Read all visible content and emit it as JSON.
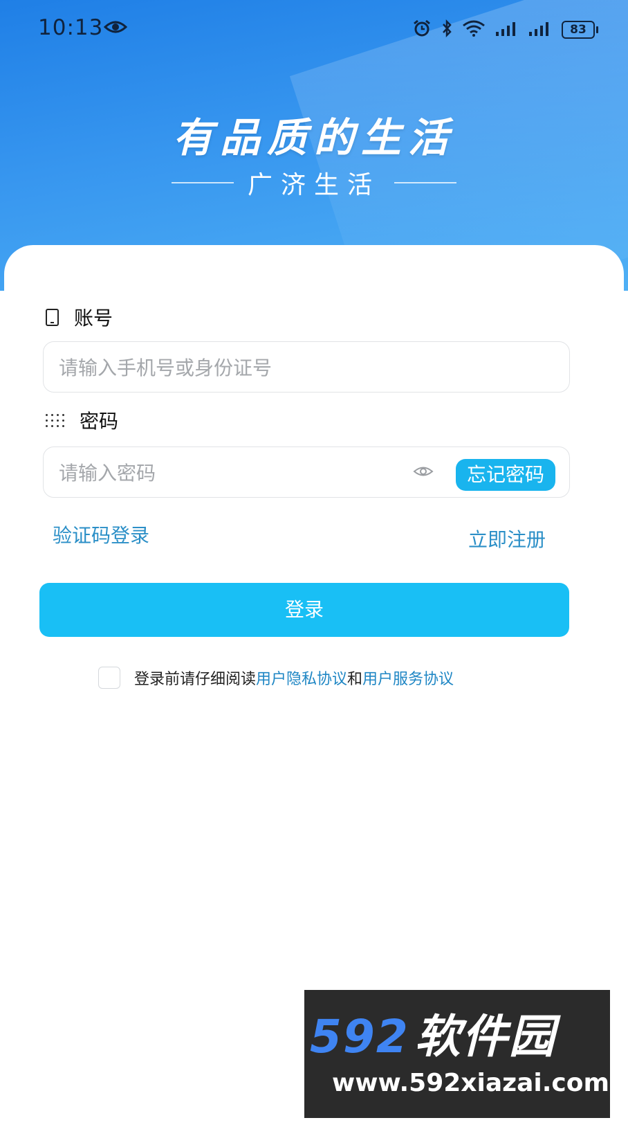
{
  "status_bar": {
    "time": "10:13",
    "battery": "83",
    "icons": [
      "eye-icon",
      "alarm-icon",
      "bluetooth-icon",
      "wifi-icon",
      "signal-icon",
      "signal-icon",
      "battery-icon"
    ]
  },
  "header": {
    "slogan": "有品质的生活",
    "brand": "广济生活"
  },
  "form": {
    "account_label": "账号",
    "account_placeholder": "请输入手机号或身份证号",
    "password_label": "密码",
    "password_placeholder": "请输入密码",
    "forgot_label": "忘记密码",
    "sms_login_label": "验证码登录",
    "register_label": "立即注册",
    "login_label": "登录"
  },
  "agreement": {
    "prefix": "登录前请仔细阅读",
    "privacy_link": "用户隐私协议",
    "joiner": "和",
    "service_link": "用户服务协议"
  },
  "watermark": {
    "numbers": "592",
    "name": "软件园",
    "url": "www.592xiazai.com"
  },
  "colors": {
    "header_blue": "#2f8cec",
    "accent_cyan": "#19bff5",
    "link_blue": "#2b8fc7"
  }
}
